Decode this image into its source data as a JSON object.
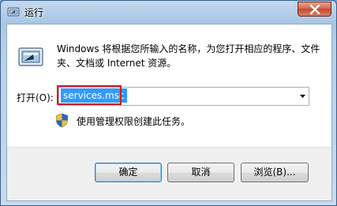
{
  "window": {
    "title": "运行",
    "icons": {
      "app": "run-app-icon",
      "close": "close-icon"
    }
  },
  "content": {
    "description": "Windows 将根据您所输入的名称，为您打开相应的程序、文件夹、文档或 Internet 资源。",
    "open_label": "打开(O):",
    "input_value": "services.msc",
    "admin_note": "使用管理权限创建此任务。",
    "icons": {
      "run": "run-program-icon",
      "shield": "uac-shield-icon",
      "dropdown": "chevron-down-icon"
    }
  },
  "buttons": {
    "ok": "确定",
    "cancel": "取消",
    "browse": "浏览(B)..."
  },
  "colors": {
    "selection": "#3399ff",
    "highlight_box": "#d9161a",
    "title_bar": "#c3d9ef",
    "close_button": "#c3482f"
  }
}
